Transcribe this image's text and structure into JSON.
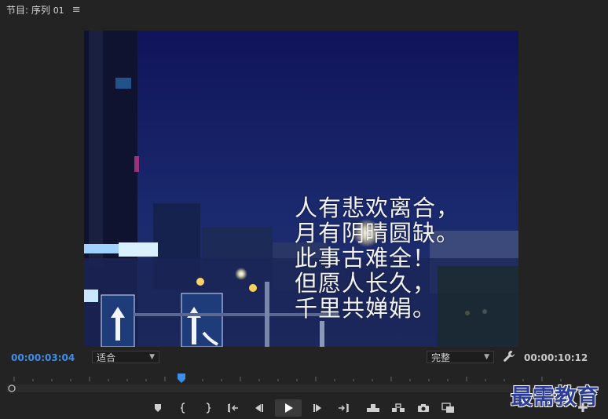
{
  "panel": {
    "title": "节目: 序列",
    "sequence_number": "01",
    "menu_icon": "hamburger-menu-icon"
  },
  "viewer": {
    "poem_lines": [
      "人有悲欢离合，",
      "月有阴晴圆缺。",
      "此事古难全！",
      "但愿人长久，",
      "千里共婵娟。"
    ]
  },
  "timecode": {
    "current": "00:00:03:04",
    "duration": "00:00:10:12"
  },
  "controls": {
    "fit_value": "适合",
    "quality_value": "完整",
    "playhead_progress": 0.31
  },
  "transport_icons": [
    "add-marker-icon",
    "mark-in-icon",
    "mark-out-icon",
    "go-to-in-icon",
    "step-back-icon",
    "play-icon",
    "step-forward-icon",
    "go-to-out-icon",
    "lift-icon",
    "extract-icon",
    "export-frame-icon",
    "comparison-view-icon",
    "add-button-icon"
  ],
  "watermark": "最需教育",
  "colors": {
    "accent_timecode": "#3d8ee8",
    "panel_bg": "#232323",
    "watermark": "#2e3e95"
  }
}
